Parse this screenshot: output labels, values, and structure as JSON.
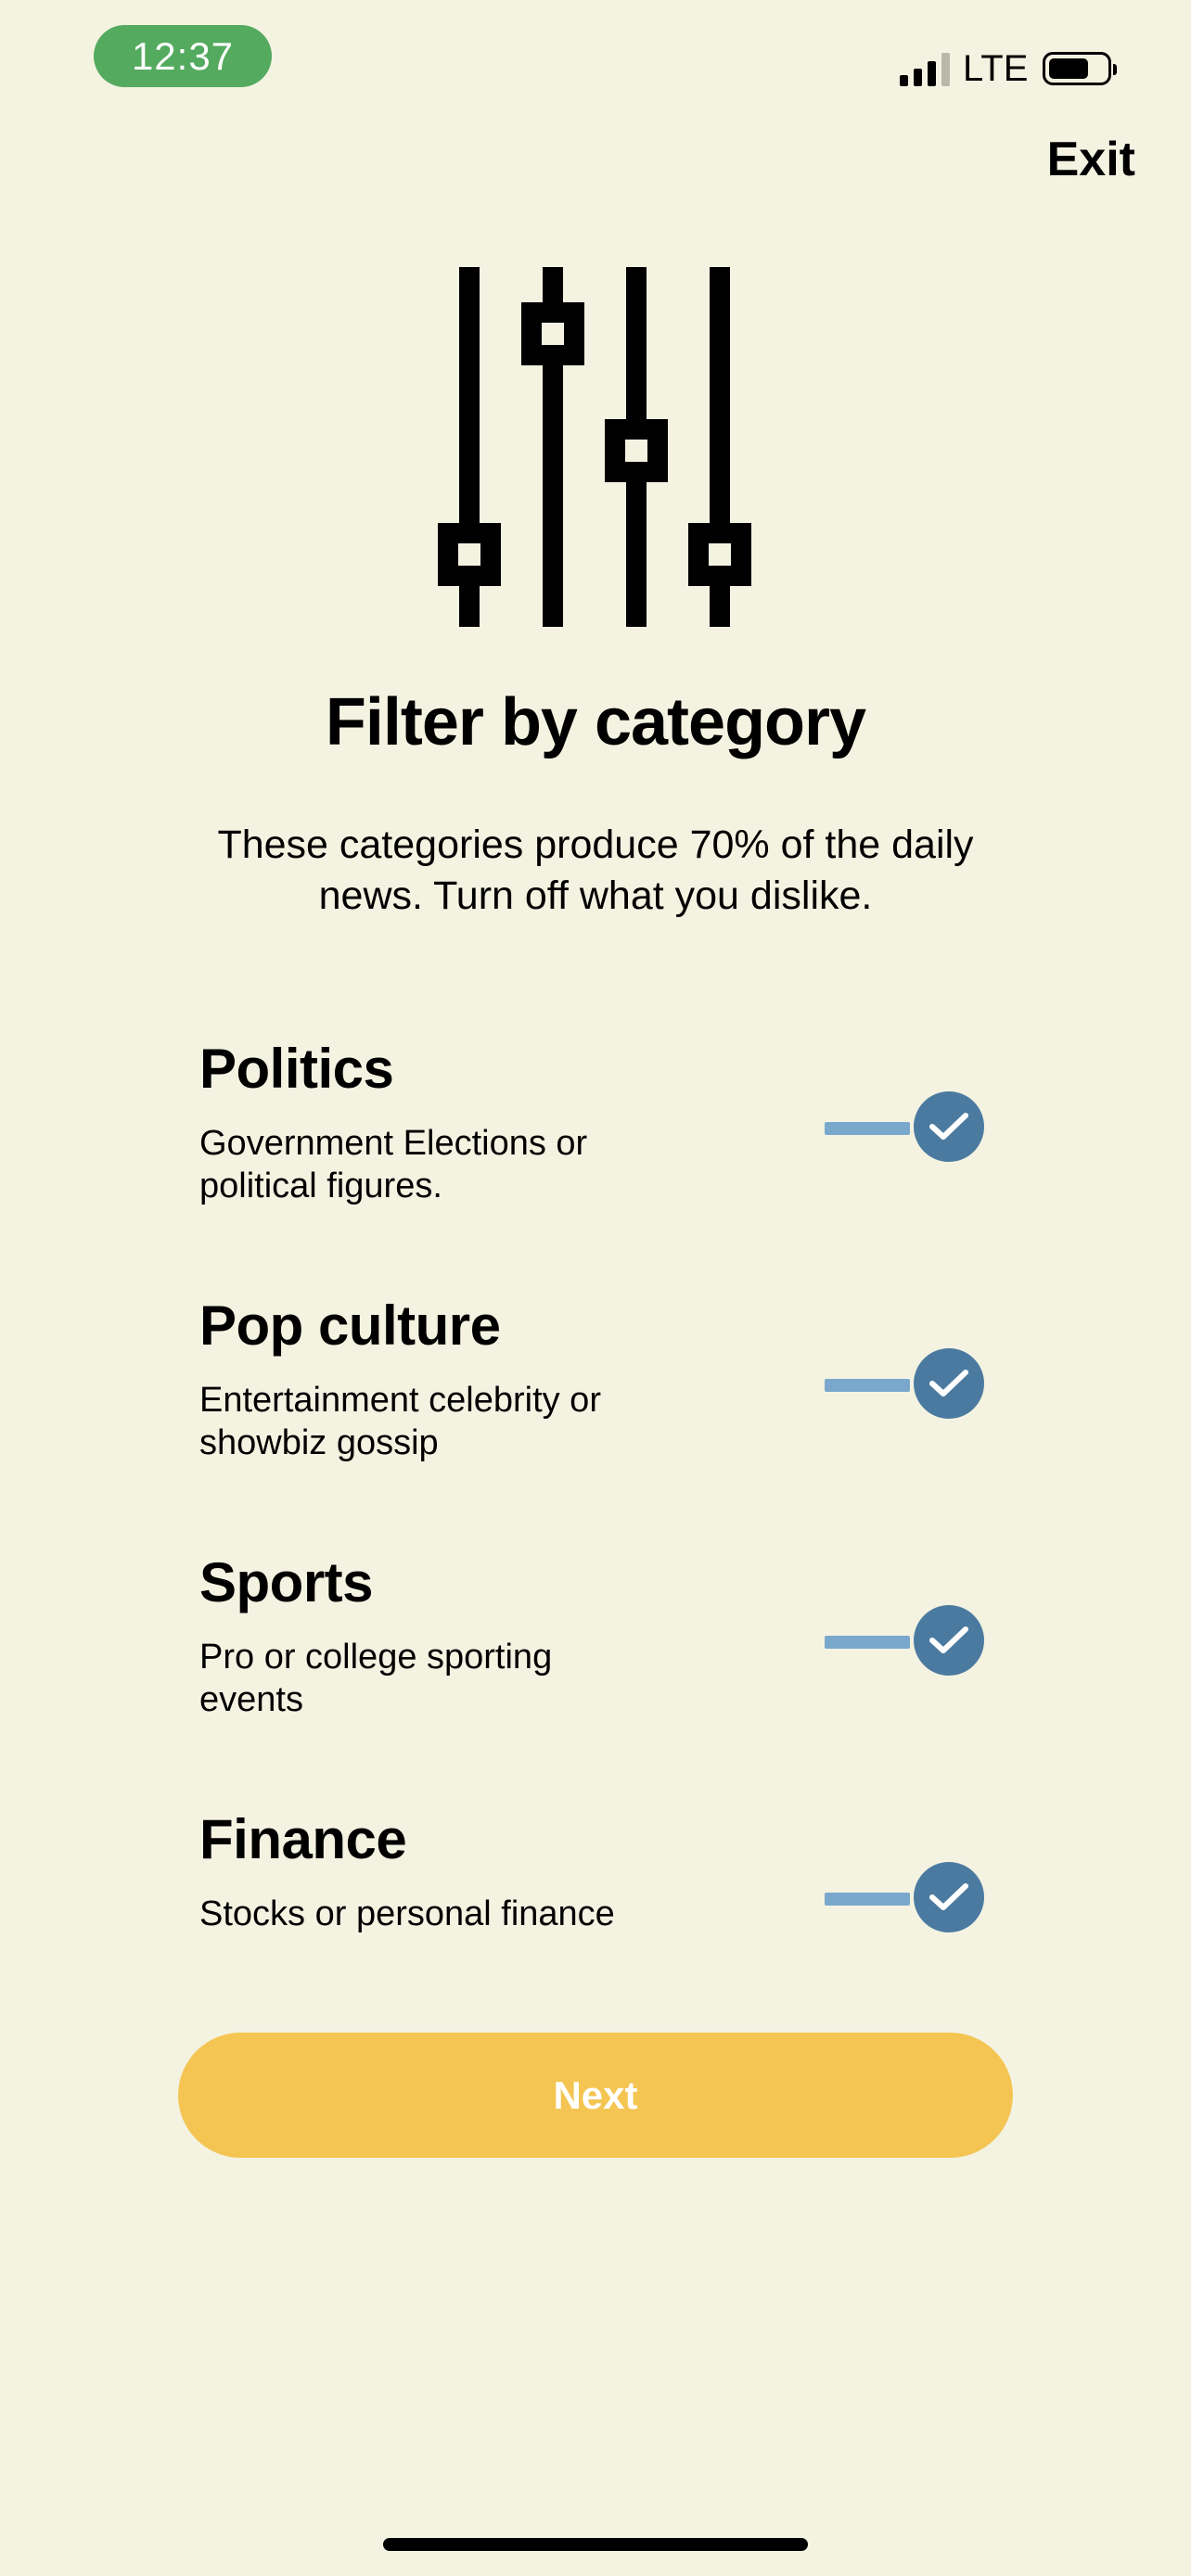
{
  "status_bar": {
    "time": "12:37",
    "network": "LTE"
  },
  "header": {
    "exit_label": "Exit"
  },
  "hero": {
    "icon": "sliders-icon",
    "title": "Filter by category",
    "subtitle": "These categories produce 70% of the daily news. Turn off what you dislike."
  },
  "categories": [
    {
      "name": "Politics",
      "description": "Government Elections or political figures.",
      "enabled": true
    },
    {
      "name": "Pop culture",
      "description": "Entertainment celebrity or showbiz gossip",
      "enabled": true
    },
    {
      "name": "Sports",
      "description": "Pro or college sporting events",
      "enabled": true
    },
    {
      "name": "Finance",
      "description": "Stocks or personal finance",
      "enabled": true
    }
  ],
  "actions": {
    "next_label": "Next"
  },
  "colors": {
    "background": "#f4f3e2",
    "time_pill": "#54aa5e",
    "toggle_track": "#7aa8cc",
    "toggle_knob": "#4b7aa0",
    "next_button": "#f4c552"
  }
}
